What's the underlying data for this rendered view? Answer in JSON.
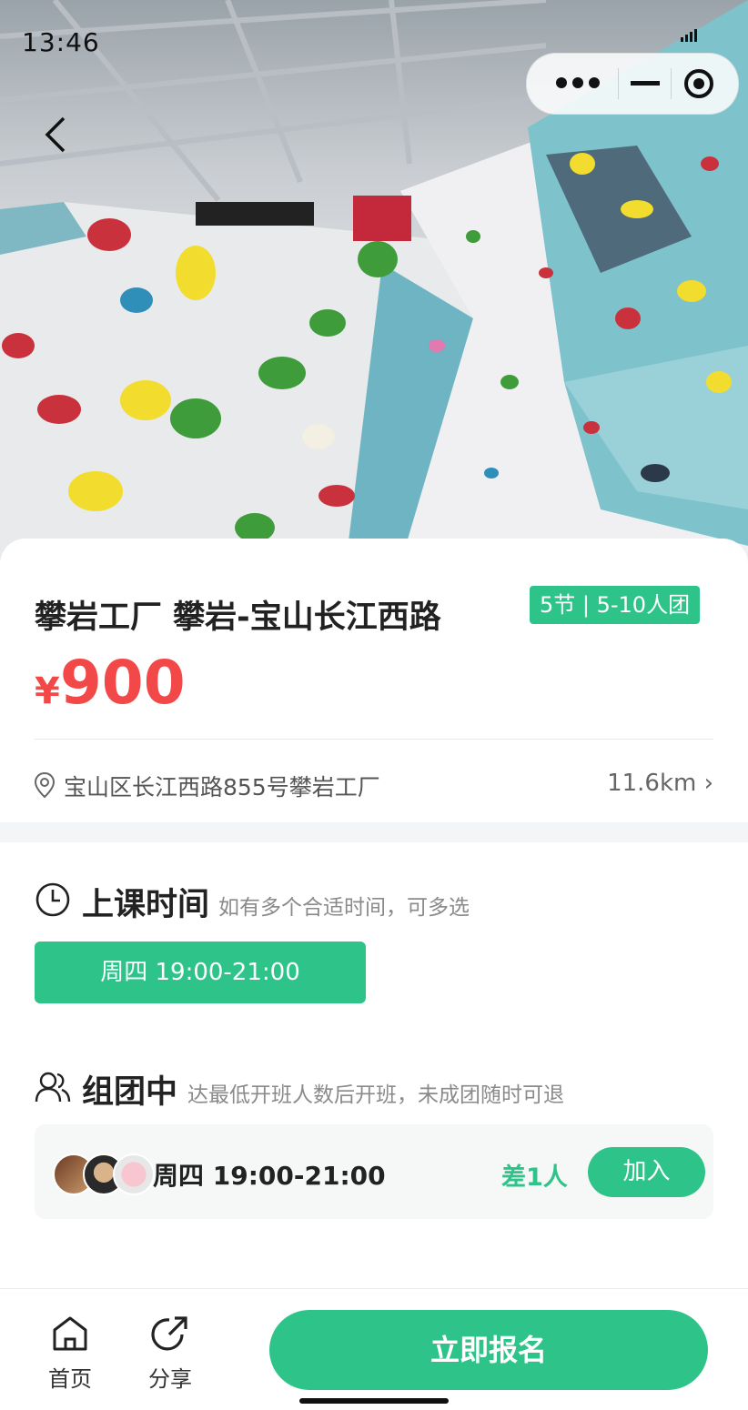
{
  "status_bar": {
    "time": "13:46"
  },
  "hero": {
    "image_description_icon": "climbing-wall-photo"
  },
  "course": {
    "title": "攀岩工厂  攀岩-宝山长江西路",
    "tag": "5节 | 5-10人团",
    "currency_symbol": "¥",
    "price": "900",
    "address": "宝山区长江西路855号攀岩工厂",
    "distance": "11.6km ›"
  },
  "schedule": {
    "title": "上课时间",
    "subtitle": "如有多个合适时间，可多选",
    "options": [
      "周四 19:00-21:00"
    ]
  },
  "group": {
    "title": "组团中",
    "subtitle": "达最低开班人数后开班，未成团随时可退",
    "day": "周四",
    "time": "19:00-21:00",
    "missing": "差1人",
    "join_label": "加入"
  },
  "bottom_bar": {
    "home_label": "首页",
    "share_label": "分享",
    "signup_label": "立即报名"
  },
  "colors": {
    "accent": "#2ec489",
    "price": "#f24848"
  }
}
